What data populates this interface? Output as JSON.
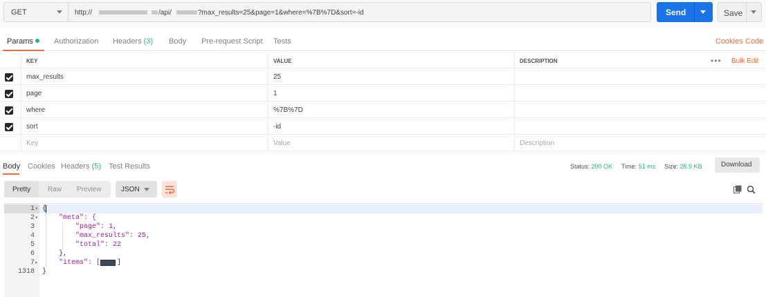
{
  "request": {
    "method": "GET",
    "url": {
      "prefix": "http://",
      "middle": "/api/",
      "suffix": "?max_results=25&page=1&where=%7B%7D&sort=-id"
    },
    "send_label": "Send",
    "save_label": "Save"
  },
  "request_tabs": {
    "params": "Params",
    "authorization": "Authorization",
    "headers": "Headers",
    "headers_count": "(3)",
    "body": "Body",
    "pre_request": "Pre-request Script",
    "tests": "Tests",
    "cookies": "Cookies",
    "code": "Code"
  },
  "params_table": {
    "headers": {
      "key": "KEY",
      "value": "VALUE",
      "description": "DESCRIPTION"
    },
    "more": "•••",
    "bulk_edit": "Bulk Edit",
    "rows": [
      {
        "key": "max_results",
        "value": "25",
        "description": ""
      },
      {
        "key": "page",
        "value": "1",
        "description": ""
      },
      {
        "key": "where",
        "value": "%7B%7D",
        "description": ""
      },
      {
        "key": "sort",
        "value": "-id",
        "description": ""
      }
    ],
    "placeholders": {
      "key": "Key",
      "value": "Value",
      "description": "Description"
    }
  },
  "response_tabs": {
    "body": "Body",
    "cookies": "Cookies",
    "headers": "Headers",
    "headers_count": "(5)",
    "test_results": "Test Results",
    "status_label": "Status:",
    "status_value": "200 OK",
    "time_label": "Time:",
    "time_value": "51 ms",
    "size_label": "Size:",
    "size_value": "28.9 KB",
    "download": "Download"
  },
  "viewer": {
    "modes": [
      "Pretty",
      "Raw",
      "Preview"
    ],
    "active_mode": "Pretty",
    "format": "JSON",
    "icons": [
      "wrap-lines-icon",
      "copy-icon",
      "search-icon"
    ]
  },
  "code": {
    "line_numbers": [
      "1",
      "2",
      "3",
      "4",
      "5",
      "6",
      "7",
      "1318"
    ],
    "lines": [
      "{",
      "\"meta\": {",
      "\"page\": 1,",
      "\"max_results\": 25,",
      "\"total\": 22",
      "},",
      "\"items\": [",
      "}"
    ]
  },
  "colors": {
    "accent": "#f26b3a",
    "send_blue": "#1a73e8",
    "success_green": "#26b47f",
    "json_key": "#a11d8f"
  }
}
